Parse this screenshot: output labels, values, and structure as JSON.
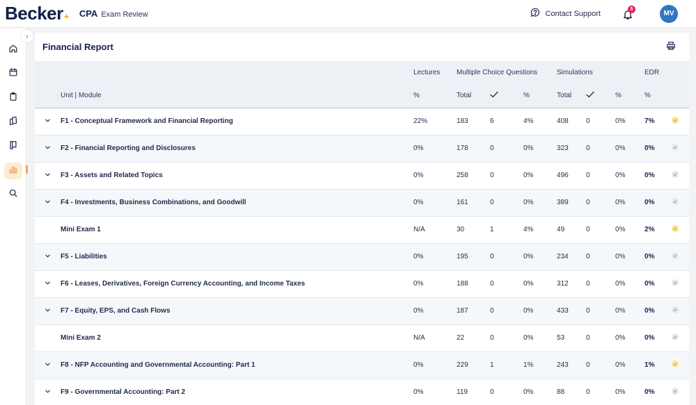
{
  "header": {
    "logo": "Becker",
    "logo_mark": "+",
    "product_name": "CPA",
    "product_sub": "Exam Review",
    "support_label": "Contact Support",
    "notification_count": "5",
    "avatar_initials": "MV"
  },
  "sidebar": {
    "collapse_icon": "chevron-right",
    "items": [
      {
        "name": "home",
        "icon": "home-icon",
        "active": false
      },
      {
        "name": "calendar",
        "icon": "calendar-icon",
        "active": false
      },
      {
        "name": "clipboard",
        "icon": "clipboard-icon",
        "active": false
      },
      {
        "name": "flashcards",
        "icon": "cards-icon",
        "active": false
      },
      {
        "name": "notes",
        "icon": "bookmark-book-icon",
        "active": false
      },
      {
        "name": "reports",
        "icon": "bar-chart-icon",
        "active": true
      },
      {
        "name": "search",
        "icon": "search-icon",
        "active": false
      }
    ]
  },
  "report": {
    "title": "Financial Report",
    "print_icon": "printer-icon",
    "group_headers": {
      "lectures": "Lectures",
      "mcq": "Multiple Choice Questions",
      "sims": "Simulations",
      "edr": "EDR"
    },
    "col_headers": {
      "unit": "Unit | Module",
      "lect_pct": "%",
      "mcq_total": "Total",
      "mcq_pct": "%",
      "sim_total": "Total",
      "sim_pct": "%",
      "edr_pct": "%"
    },
    "rows": [
      {
        "name": "F1 - Conceptual Framework and Financial Reporting",
        "expandable": true,
        "lectures": "22%",
        "mcq_total": "183",
        "mcq_correct": "6",
        "mcq_pct": "4%",
        "sim_total": "408",
        "sim_correct": "0",
        "sim_pct": "0%",
        "edr": "7%",
        "status": "active"
      },
      {
        "name": "F2 - Financial Reporting and Disclosures",
        "expandable": true,
        "lectures": "0%",
        "mcq_total": "178",
        "mcq_correct": "0",
        "mcq_pct": "0%",
        "sim_total": "323",
        "sim_correct": "0",
        "sim_pct": "0%",
        "edr": "0%",
        "status": "inactive"
      },
      {
        "name": "F3 - Assets and Related Topics",
        "expandable": true,
        "lectures": "0%",
        "mcq_total": "258",
        "mcq_correct": "0",
        "mcq_pct": "0%",
        "sim_total": "496",
        "sim_correct": "0",
        "sim_pct": "0%",
        "edr": "0%",
        "status": "inactive"
      },
      {
        "name": "F4 - Investments, Business Combinations, and Goodwill",
        "expandable": true,
        "lectures": "0%",
        "mcq_total": "161",
        "mcq_correct": "0",
        "mcq_pct": "0%",
        "sim_total": "389",
        "sim_correct": "0",
        "sim_pct": "0%",
        "edr": "0%",
        "status": "inactive"
      },
      {
        "name": "Mini Exam 1",
        "expandable": false,
        "lectures": "N/A",
        "mcq_total": "30",
        "mcq_correct": "1",
        "mcq_pct": "4%",
        "sim_total": "49",
        "sim_correct": "0",
        "sim_pct": "0%",
        "edr": "2%",
        "status": "active"
      },
      {
        "name": "F5 - Liabilities",
        "expandable": true,
        "lectures": "0%",
        "mcq_total": "195",
        "mcq_correct": "0",
        "mcq_pct": "0%",
        "sim_total": "234",
        "sim_correct": "0",
        "sim_pct": "0%",
        "edr": "0%",
        "status": "inactive"
      },
      {
        "name": "F6 - Leases, Derivatives, Foreign Currency Accounting, and Income Taxes",
        "expandable": true,
        "lectures": "0%",
        "mcq_total": "188",
        "mcq_correct": "0",
        "mcq_pct": "0%",
        "sim_total": "312",
        "sim_correct": "0",
        "sim_pct": "0%",
        "edr": "0%",
        "status": "inactive"
      },
      {
        "name": "F7 - Equity, EPS, and Cash Flows",
        "expandable": true,
        "lectures": "0%",
        "mcq_total": "187",
        "mcq_correct": "0",
        "mcq_pct": "0%",
        "sim_total": "433",
        "sim_correct": "0",
        "sim_pct": "0%",
        "edr": "0%",
        "status": "inactive"
      },
      {
        "name": "Mini Exam 2",
        "expandable": false,
        "lectures": "N/A",
        "mcq_total": "22",
        "mcq_correct": "0",
        "mcq_pct": "0%",
        "sim_total": "53",
        "sim_correct": "0",
        "sim_pct": "0%",
        "edr": "0%",
        "status": "inactive"
      },
      {
        "name": "F8 - NFP Accounting and Governmental Accounting: Part 1",
        "expandable": true,
        "lectures": "0%",
        "mcq_total": "229",
        "mcq_correct": "1",
        "mcq_pct": "1%",
        "sim_total": "243",
        "sim_correct": "0",
        "sim_pct": "0%",
        "edr": "1%",
        "status": "active"
      },
      {
        "name": "F9 - Governmental Accounting: Part 2",
        "expandable": true,
        "lectures": "0%",
        "mcq_total": "119",
        "mcq_correct": "0",
        "mcq_pct": "0%",
        "sim_total": "88",
        "sim_correct": "0",
        "sim_pct": "0%",
        "edr": "0%",
        "status": "inactive"
      }
    ]
  },
  "colors": {
    "brand_navy": "#15204a",
    "accent_orange": "#f5a623",
    "badge_active": "#fbe29a",
    "badge_inactive": "#e3e8ec",
    "notification_red": "#e0245e",
    "avatar_blue": "#2f78c4"
  }
}
